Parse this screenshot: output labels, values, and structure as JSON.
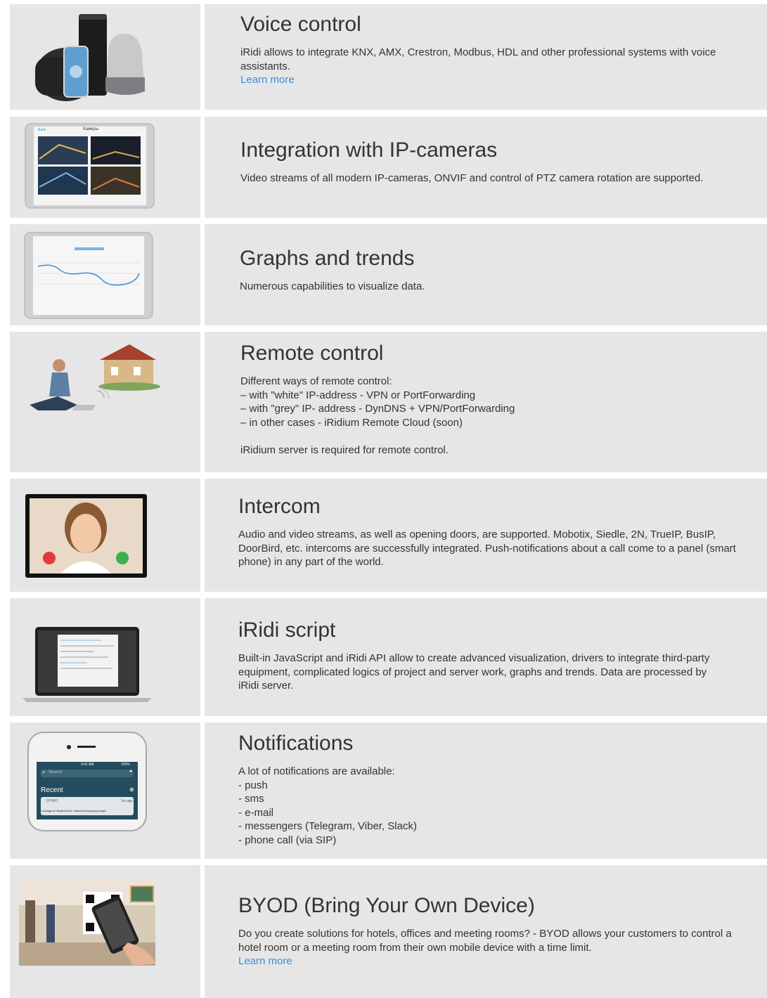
{
  "features": [
    {
      "id": "voice",
      "title": "Voice control",
      "lines": [
        "iRidi allows to integrate KNX, AMX, Crestron, Modbus, HDL and other professional systems with voice",
        "assistants."
      ],
      "link": "Learn more",
      "image": "smart-speakers"
    },
    {
      "id": "ipcam",
      "title": "Integration with IP-cameras",
      "lines": [
        "Video streams of all modern IP-cameras, ONVIF and control of PTZ camera rotation are supported."
      ],
      "image": "tablet-camera-grid",
      "screen_header": "Камеры",
      "screen_back": "Back"
    },
    {
      "id": "graphs",
      "title": "Graphs and trends",
      "lines": [
        "Numerous capabilities to visualize data."
      ],
      "image": "tablet-line-graph"
    },
    {
      "id": "remote",
      "title": "Remote control",
      "lines": [
        "Different ways of remote control:",
        "– with \"white\" IP-address - VPN or PortForwarding",
        "– with \"grey\" IP- address - DynDNS + VPN/PortForwarding",
        "– in other cases - iRidium Remote Cloud (soon)",
        "",
        "iRidium server is required for remote control."
      ],
      "image": "man-laptop-house"
    },
    {
      "id": "intercom",
      "title": "Intercom",
      "lines": [
        "Audio and video streams, as well as opening doors, are supported. Mobotix, Siedle, 2N, TrueIP, BusIP,",
        "DoorBird, etc. intercoms are successfully integrated. Push-notifications about a call come to a panel (smart",
        "phone) in any part of the world."
      ],
      "image": "intercom-call-screen"
    },
    {
      "id": "script",
      "title": "iRidi script",
      "lines": [
        "Built-in JavaScript and iRidi API allow to create advanced visualization, drivers to integrate third-party",
        "equipment, complicated logics of project and server work, graphs and trends. Data are processed by",
        "iRidi server."
      ],
      "image": "laptop-code-editor"
    },
    {
      "id": "notify",
      "title": "Notifications",
      "lines": [
        "A lot of notifications are available:",
        "- push",
        "- sms",
        "- e-mail",
        "- messengers (Telegram, Viber, Slack)",
        "- phone call (via SIP)"
      ],
      "image": "phone-notification",
      "phone": {
        "time": "9:41 AM",
        "battery": "100%",
        "search": "Search",
        "recent": "Recent",
        "app": "i3 PRO",
        "ago": "1m ago",
        "message": "Leckage im Badezimmer. Wasserversorgung stoppt."
      }
    },
    {
      "id": "byod",
      "title": "BYOD (Bring Your Own Device)",
      "lines": [
        "Do you create solutions for hotels, offices and meeting rooms? - BYOD allows your customers to control a",
        "hotel room or a meeting room from their own mobile device with a time limit."
      ],
      "link": "Learn more",
      "image": "hotel-qr-phone"
    }
  ],
  "colors": {
    "cell_bg": "#e6e6e6",
    "text": "#333333",
    "link": "#3a8fd9"
  }
}
